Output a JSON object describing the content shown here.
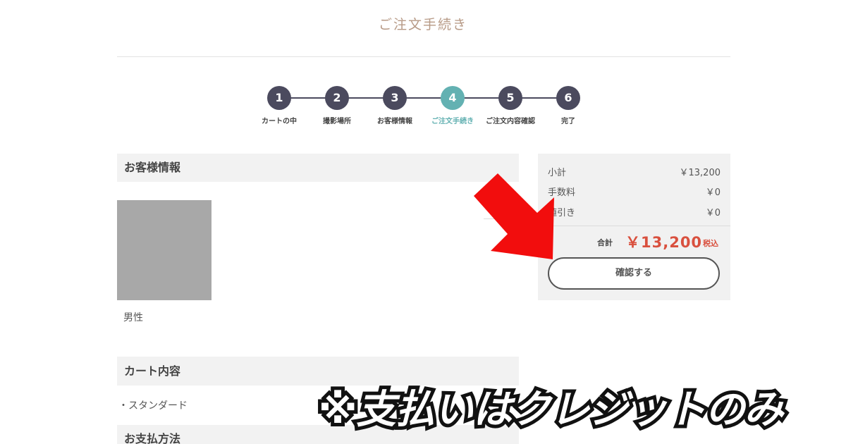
{
  "page_title": "ご注文手続き",
  "steps": [
    {
      "num": "1",
      "label": "カートの中"
    },
    {
      "num": "2",
      "label": "撮影場所"
    },
    {
      "num": "3",
      "label": "お客様情報"
    },
    {
      "num": "4",
      "label": "ご注文手続き"
    },
    {
      "num": "5",
      "label": "ご注文内容確認"
    },
    {
      "num": "6",
      "label": "完了"
    }
  ],
  "active_step": 4,
  "sections": {
    "customer_info": "お客様情報",
    "cart_contents": "カート内容",
    "payment_method": "お支払方法"
  },
  "customer": {
    "gender": "男性"
  },
  "cart": {
    "item": "・スタンダード"
  },
  "summary": {
    "subtotal_label": "小計",
    "subtotal_value": "￥13,200",
    "fee_label": "手数料",
    "fee_value": "￥0",
    "discount_label": "値引き",
    "discount_value": "￥0",
    "total_label": "合計",
    "total_value": "￥13,200",
    "tax_label": "税込",
    "confirm_label": "確認する"
  },
  "overlay": {
    "banner_text": "※支払いはクレジットのみ",
    "arrow_color": "#f20d0d"
  },
  "colors": {
    "title": "#b79a86",
    "step": "#4b4a5e",
    "step_active": "#63b1b2",
    "total": "#d9503e"
  }
}
